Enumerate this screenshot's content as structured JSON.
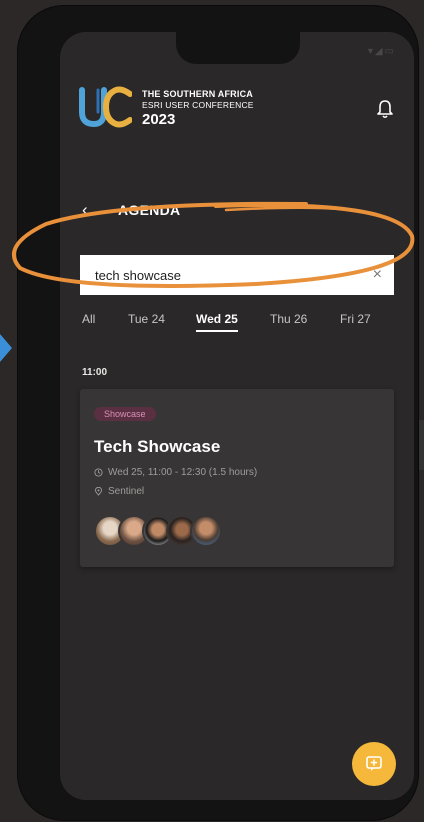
{
  "logo": {
    "line1": "THE SOUTHERN AFRICA",
    "line2": "ESRI USER CONFERENCE",
    "year": "2023"
  },
  "header": {
    "back_icon": "chevron-left-icon",
    "title": "AGENDA",
    "bell_icon": "bell-icon"
  },
  "search": {
    "value": "tech showcase",
    "clear_icon": "close-icon"
  },
  "tabs": [
    {
      "label": "All",
      "active": false
    },
    {
      "label": "Tue 24",
      "active": false
    },
    {
      "label": "Wed 25",
      "active": true
    },
    {
      "label": "Thu 26",
      "active": false
    },
    {
      "label": "Fri 27",
      "active": false
    }
  ],
  "agenda": {
    "time": "11:00",
    "session": {
      "badge": "Showcase",
      "title": "Tech Showcase",
      "time_range": "Wed 25, 11:00 - 12:30 (1.5 hours)",
      "location": "Sentinel"
    }
  },
  "colors": {
    "accent_blue": "#3b8fd8",
    "highlight_orange": "#e8903a",
    "fab_yellow": "#f5b83a",
    "badge_bg": "#5a2f42",
    "badge_text": "#d691b5"
  }
}
